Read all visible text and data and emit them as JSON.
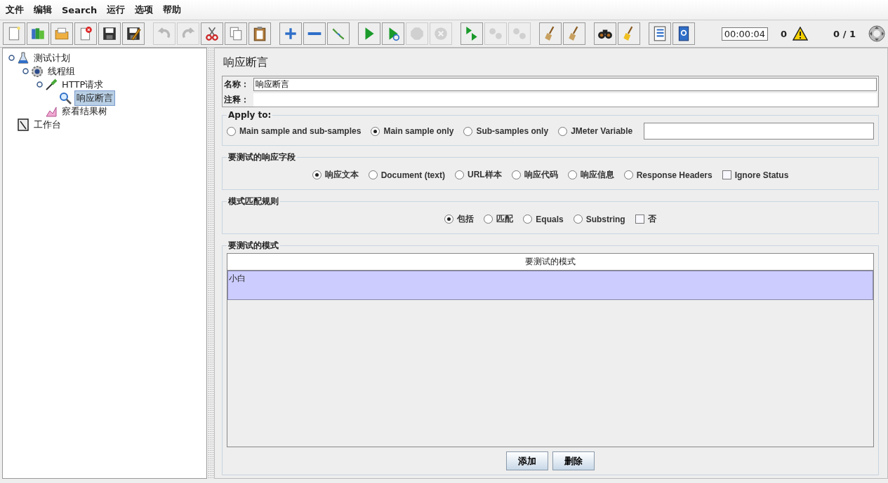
{
  "menu": [
    "文件",
    "编辑",
    "Search",
    "运行",
    "选项",
    "帮助"
  ],
  "toolbar": {
    "groups": [
      [
        {
          "kind": "new",
          "disabled": false
        },
        {
          "kind": "templates",
          "disabled": false
        },
        {
          "kind": "open",
          "disabled": false
        },
        {
          "kind": "close",
          "disabled": false
        },
        {
          "kind": "save",
          "disabled": false
        },
        {
          "kind": "save-as",
          "disabled": false
        }
      ],
      [
        {
          "kind": "undo",
          "disabled": true
        },
        {
          "kind": "redo",
          "disabled": true
        },
        {
          "kind": "cut",
          "disabled": false
        },
        {
          "kind": "copy",
          "disabled": false
        },
        {
          "kind": "paste",
          "disabled": false
        }
      ],
      [
        {
          "kind": "add",
          "disabled": false
        },
        {
          "kind": "remove",
          "disabled": false
        },
        {
          "kind": "toggle",
          "disabled": false
        }
      ],
      [
        {
          "kind": "start",
          "disabled": false
        },
        {
          "kind": "start-no-pause",
          "disabled": false
        },
        {
          "kind": "stop",
          "disabled": true
        },
        {
          "kind": "shutdown",
          "disabled": true
        }
      ],
      [
        {
          "kind": "remote-start",
          "disabled": false
        },
        {
          "kind": "remote-stop",
          "disabled": true
        },
        {
          "kind": "remote-exit",
          "disabled": true
        }
      ],
      [
        {
          "kind": "clear",
          "disabled": false
        },
        {
          "kind": "clear-all",
          "disabled": false
        }
      ],
      [
        {
          "kind": "search",
          "disabled": false
        },
        {
          "kind": "reset-search",
          "disabled": false
        }
      ],
      [
        {
          "kind": "function-helper",
          "disabled": false
        },
        {
          "kind": "help",
          "disabled": false
        }
      ]
    ],
    "timer": "00:00:04",
    "warnings": "0",
    "threads": "0 / 1"
  },
  "tree": [
    {
      "label": "测试计划",
      "kind": "test-plan",
      "selected": false,
      "expanded": true,
      "children": [
        {
          "label": "线程组",
          "kind": "thread-group",
          "selected": false,
          "expanded": true,
          "children": [
            {
              "label": "HTTP请求",
              "kind": "sampler",
              "selected": false,
              "expanded": true,
              "children": [
                {
                  "label": "响应断言",
                  "kind": "assertion",
                  "selected": true
                }
              ]
            },
            {
              "label": "察看结果树",
              "kind": "listener",
              "selected": false
            }
          ]
        }
      ]
    },
    {
      "label": "工作台",
      "kind": "workbench",
      "selected": false
    }
  ],
  "panel": {
    "title": "响应断言",
    "name_label": "名称：",
    "name_value": "响应断言",
    "comment_label": "注释：",
    "apply_to": {
      "legend": "Apply to:",
      "options": [
        {
          "label": "Main sample and sub-samples",
          "selected": false
        },
        {
          "label": "Main sample only",
          "selected": true
        },
        {
          "label": "Sub-samples only",
          "selected": false
        },
        {
          "label": "JMeter Variable",
          "selected": false
        }
      ]
    },
    "field_to_test": {
      "legend": "要测试的响应字段",
      "options": [
        {
          "kind": "radio",
          "label": "响应文本",
          "selected": true
        },
        {
          "kind": "radio",
          "label": "Document (text)",
          "selected": false
        },
        {
          "kind": "radio",
          "label": "URL样本",
          "selected": false
        },
        {
          "kind": "radio",
          "label": "响应代码",
          "selected": false
        },
        {
          "kind": "radio",
          "label": "响应信息",
          "selected": false
        },
        {
          "kind": "radio",
          "label": "Response Headers",
          "selected": false
        },
        {
          "kind": "checkbox",
          "label": "Ignore Status",
          "checked": false
        }
      ]
    },
    "matching_rules": {
      "legend": "模式匹配规则",
      "options": [
        {
          "kind": "radio",
          "label": "包括",
          "selected": true
        },
        {
          "kind": "radio",
          "label": "匹配",
          "selected": false
        },
        {
          "kind": "radio",
          "label": "Equals",
          "selected": false
        },
        {
          "kind": "radio",
          "label": "Substring",
          "selected": false
        },
        {
          "kind": "checkbox",
          "label": "否",
          "checked": false
        }
      ]
    },
    "patterns": {
      "legend": "要测试的模式",
      "column": "要测试的模式",
      "rows": [
        {
          "text": "小白",
          "selected": true
        }
      ]
    },
    "buttons": [
      "添加",
      "删除"
    ]
  }
}
